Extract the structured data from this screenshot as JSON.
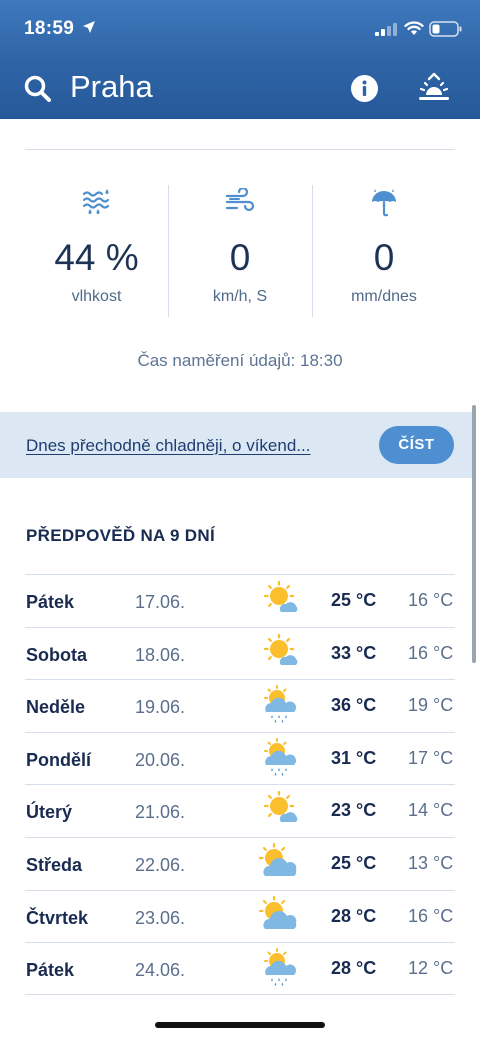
{
  "status_bar": {
    "time": "18:59"
  },
  "nav": {
    "city": "Praha"
  },
  "current": {
    "humidity": {
      "value": "44 %",
      "unit": "vlhkost",
      "icon": "humidity-icon"
    },
    "wind": {
      "value": "0",
      "unit": "km/h, S",
      "icon": "wind-icon"
    },
    "rain": {
      "value": "0",
      "unit": "mm/dnes",
      "icon": "umbrella-icon"
    },
    "measured_at": "Čas naměření údajů: 18:30"
  },
  "banner": {
    "text": "Dnes přechodně chladněji, o víkend...",
    "button": "ČÍST"
  },
  "forecast": {
    "title": "PŘEDPOVĚĎ NA 9 DNÍ",
    "days": [
      {
        "day": "Pátek",
        "date": "17.06.",
        "high": "25 °C",
        "low": "16 °C",
        "icon": "sunny-cloud"
      },
      {
        "day": "Sobota",
        "date": "18.06.",
        "high": "33 °C",
        "low": "16 °C",
        "icon": "sunny-cloud"
      },
      {
        "day": "Neděle",
        "date": "19.06.",
        "high": "36 °C",
        "low": "19 °C",
        "icon": "sun-cloud-rain"
      },
      {
        "day": "Pondělí",
        "date": "20.06.",
        "high": "31 °C",
        "low": "17 °C",
        "icon": "sun-cloud-rain"
      },
      {
        "day": "Úterý",
        "date": "21.06.",
        "high": "23 °C",
        "low": "14 °C",
        "icon": "sunny-cloud"
      },
      {
        "day": "Středa",
        "date": "22.06.",
        "high": "25 °C",
        "low": "13 °C",
        "icon": "partly-cloudy"
      },
      {
        "day": "Čtvrtek",
        "date": "23.06.",
        "high": "28 °C",
        "low": "16 °C",
        "icon": "partly-cloudy"
      },
      {
        "day": "Pátek",
        "date": "24.06.",
        "high": "28 °C",
        "low": "12 °C",
        "icon": "sun-cloud-rain"
      }
    ]
  },
  "colors": {
    "header": "#2e64a6",
    "accent": "#4d8fd0",
    "banner": "#dbe8f4"
  }
}
